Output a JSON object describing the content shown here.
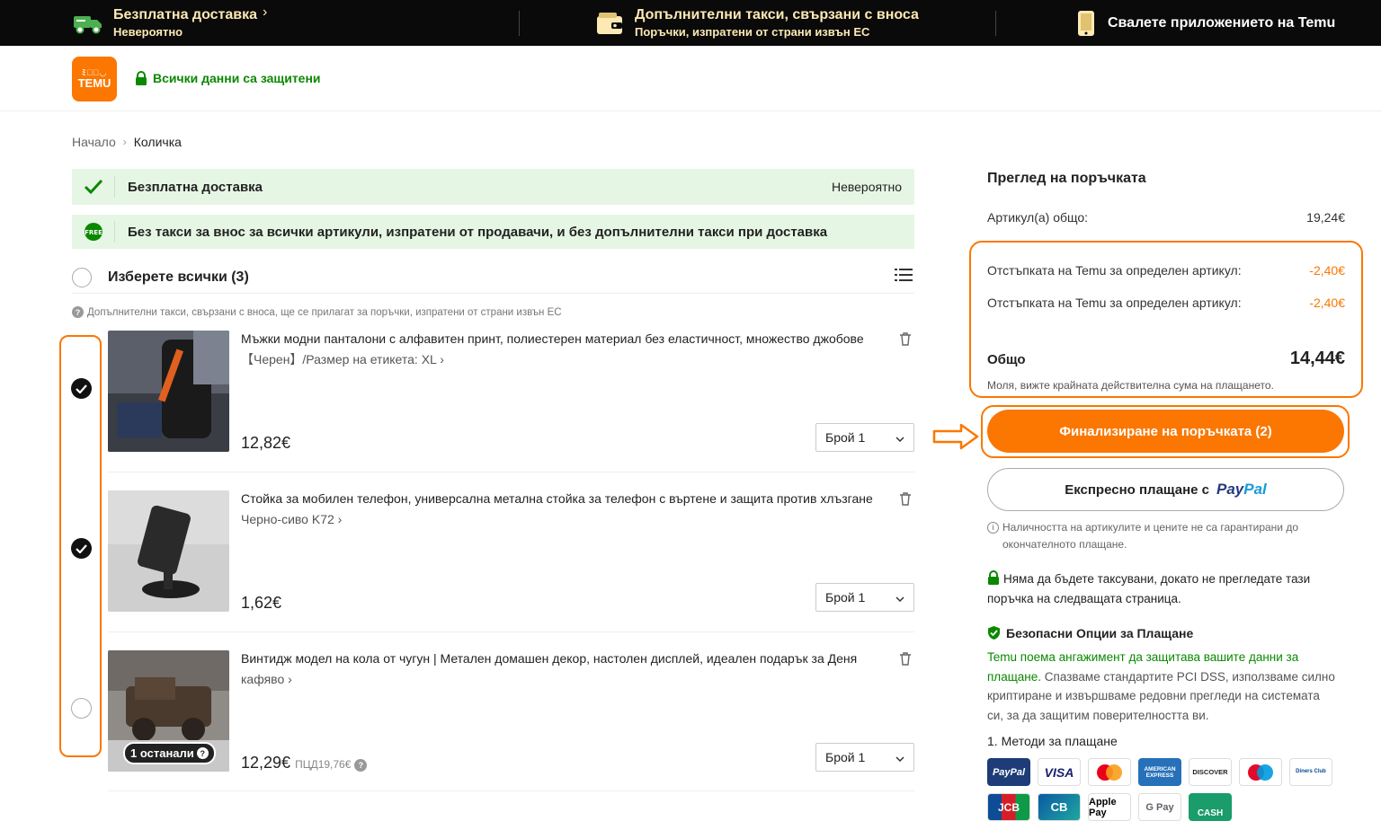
{
  "topbar": {
    "seg1_title": "Безплатна доставка",
    "seg1_sub": "Невероятно",
    "seg2_title": "Допълнителни такси, свързани с вноса",
    "seg2_sub": "Поръчки, изпратени от страни извън ЕС",
    "seg3_title": "Свалете приложението на Temu"
  },
  "header": {
    "logo_top": "ﾐ℁ﾞ◡",
    "logo_bottom": "TEMU",
    "secure_text": "Всички данни са защитени"
  },
  "breadcrumb": {
    "home": "Начало",
    "sep": "›",
    "current": "Количка"
  },
  "banners": {
    "shipping": "Безплатна доставка",
    "shipping_right": "Невероятно",
    "free_badge": "FREE",
    "taxes": "Без такси за внос за всички артикули, изпратени от продавачи, и без допълнителни такси при доставка"
  },
  "select_all": "Изберете всички (3)",
  "notice": "Допълнителни такси, свързани с вноса, ще се прилагат за поръчки, изпратени от страни извън ЕС",
  "items": [
    {
      "title": "Мъжки модни панталони с алфавитен принт, полиестерен материал без еластичност, множество джобове",
      "variant": "【Черен】/Размер на етикета: XL ›",
      "price": "12,82€",
      "qty": "Брой 1",
      "checked": true
    },
    {
      "title": "Стойка за мобилен телефон, универсална метална стойка за телефон с въртене и защита против хлъзгане",
      "variant": "Черно-сиво K72 ›",
      "price": "1,62€",
      "qty": "Брой 1",
      "checked": true
    },
    {
      "title": "Винтидж модел на кола от чугун | Метален домашен декор, настолен дисплей, идеален подарък за Деня",
      "variant": "кафяво ›",
      "price": "12,29€",
      "old_price": "ПЦД19,76€",
      "badge": "1 останали",
      "qty": "Брой 1",
      "checked": false
    }
  ],
  "summary": {
    "title": "Преглед на поръчката",
    "items_total_label": "Артикул(а) общо:",
    "items_total_value": "19,24€",
    "discount1_label": "Отстъпката на Temu за определен артикул:",
    "discount1_value": "-2,40€",
    "discount2_label": "Отстъпката на Temu за определен артикул:",
    "discount2_value": "-2,40€",
    "total_label": "Общо",
    "total_value": "14,44€",
    "total_note": "Моля, вижте крайната действителна сума на плащането.",
    "checkout_button": "Финализиране на поръчката (2)",
    "paypal_button": "Експресно плащане с",
    "paypal_p1": "Pay",
    "paypal_p2": "Pal",
    "availability_note": "Наличността на артикулите и цените не са гарантирани до окончателното плащане.",
    "lock_note": "Няма да бъдете таксувани, докато не прегледате тази поръчка на следващата страница.",
    "secure_pay_title": "Безопасни Опции за Плащане",
    "secure_desc_green": "Temu поема ангажимент да защитава вашите данни за плащане.",
    "secure_desc_rest": " Спазваме стандартите PCI DSS, използваме силно криптиране и извършваме редовни прегледи на системата си, за да защитим поверителността ви.",
    "methods_title": "1. Методи за плащане",
    "methods_row1": [
      "PayPal",
      "VISA",
      "Mastercard",
      "AMERICAN EXPRESS",
      "DISCOVER",
      "Maestro",
      "Diners Club"
    ],
    "methods_row2": [
      "JCB",
      "CB",
      "Apple Pay",
      "G Pay",
      "CASH"
    ]
  },
  "colors": {
    "accent": "#fb7701",
    "green": "#0a8800",
    "banner_bg": "#e6f6e4"
  }
}
